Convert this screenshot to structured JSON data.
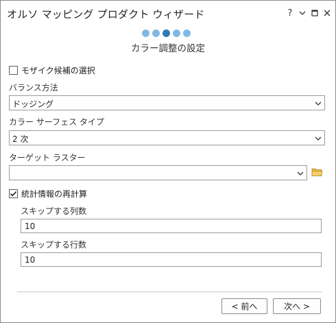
{
  "window": {
    "title": "オルソ マッピング プロダクト ウィザード",
    "controls": {
      "help": "?",
      "options_icon": "chevron-down-icon",
      "restore_icon": "restore-icon",
      "close_icon": "close-icon"
    }
  },
  "steps": {
    "count": 5,
    "active_index": 2,
    "active_color": "#2f79b6",
    "inactive_color": "#7fb9e3"
  },
  "page_title": "カラー調整の設定",
  "mosaic_candidates": {
    "label": "モザイク候補の選択",
    "checked": false
  },
  "balance_method": {
    "label": "バランス方法",
    "value": "ドッジング"
  },
  "color_surface_type": {
    "label": "カラー サーフェス タイプ",
    "value": "2 次"
  },
  "target_raster": {
    "label": "ターゲット ラスター",
    "value": "",
    "browse_icon": "folder-icon"
  },
  "recompute_statistics": {
    "label": "統計情報の再計算",
    "checked": true
  },
  "skip_columns": {
    "label": "スキップする列数",
    "value": "10"
  },
  "skip_rows": {
    "label": "スキップする行数",
    "value": "10"
  },
  "buttons": {
    "back": "< 前へ",
    "next": "次へ >"
  }
}
